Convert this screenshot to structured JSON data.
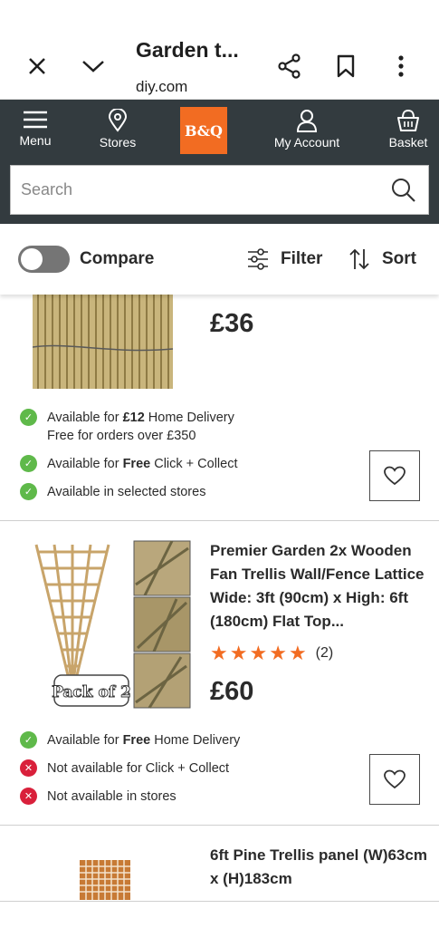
{
  "browser": {
    "title": "Garden t...",
    "url": "diy.com"
  },
  "header": {
    "logo_text": "B&Q",
    "nav": {
      "menu": "Menu",
      "stores": "Stores",
      "account": "My Account",
      "basket": "Basket"
    },
    "search_placeholder": "Search"
  },
  "filters": {
    "compare_label": "Compare",
    "compare_on": false,
    "filter_label": "Filter",
    "sort_label": "Sort"
  },
  "products": [
    {
      "price": "£36",
      "availability": {
        "delivery_prefix": "Available for ",
        "delivery_bold": "£12",
        "delivery_suffix": " Home Delivery",
        "delivery_note": "Free for orders over £350",
        "collect_prefix": "Available for ",
        "collect_bold": "Free",
        "collect_suffix": " Click + Collect",
        "stores": "Available in selected stores"
      }
    },
    {
      "title": "Premier Garden 2x Wooden Fan Trellis Wall/Fence Lattice Wide: 3ft (90cm) x High: 6ft (180cm) Flat Top...",
      "rating": 5,
      "review_count": "(2)",
      "badge": "Pack of 2",
      "price": "£60",
      "availability": {
        "delivery_prefix": "Available for ",
        "delivery_bold": "Free",
        "delivery_suffix": " Home Delivery",
        "collect": "Not available for Click + Collect",
        "stores": "Not available in stores"
      }
    },
    {
      "title": "6ft Pine Trellis panel (W)63cm x (H)183cm"
    }
  ],
  "colors": {
    "brand_orange": "#f26c22",
    "header_dark": "#333b3f",
    "available_green": "#5fb94a",
    "unavailable_red": "#d9203b"
  }
}
